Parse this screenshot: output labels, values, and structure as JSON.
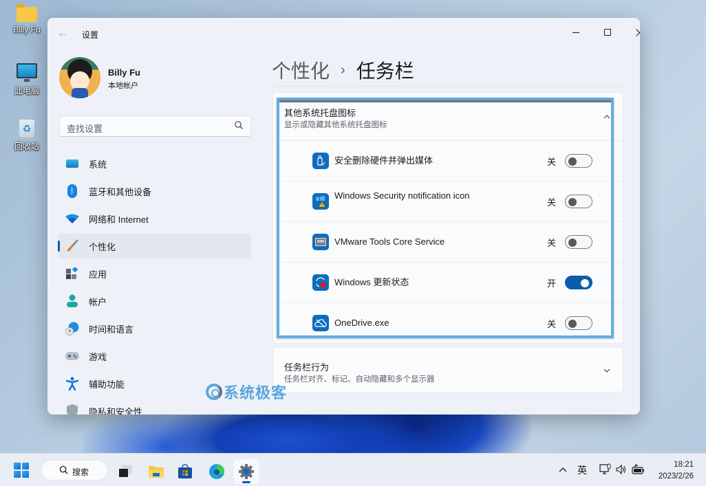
{
  "desktop": {
    "icons": [
      {
        "label": "Billy Fu",
        "icon": "folder-icon"
      },
      {
        "label": "此电脑",
        "icon": "computer-icon"
      },
      {
        "label": "回收站",
        "icon": "recycle-bin-icon"
      }
    ]
  },
  "window": {
    "title": "设置",
    "controls": {
      "minimize": "minimize",
      "maximize": "maximize",
      "close": "close"
    }
  },
  "user": {
    "name": "Billy Fu",
    "account_type": "本地帐户"
  },
  "search": {
    "placeholder": "查找设置"
  },
  "sidebar": {
    "items": [
      {
        "label": "系统",
        "icon": "system-icon",
        "active": false
      },
      {
        "label": "蓝牙和其他设备",
        "icon": "bluetooth-icon",
        "active": false
      },
      {
        "label": "网络和 Internet",
        "icon": "wifi-icon",
        "active": false
      },
      {
        "label": "个性化",
        "icon": "paintbrush-icon",
        "active": true
      },
      {
        "label": "应用",
        "icon": "apps-icon",
        "active": false
      },
      {
        "label": "帐户",
        "icon": "account-icon",
        "active": false
      },
      {
        "label": "时间和语言",
        "icon": "time-language-icon",
        "active": false
      },
      {
        "label": "游戏",
        "icon": "gamepad-icon",
        "active": false
      },
      {
        "label": "辅助功能",
        "icon": "accessibility-icon",
        "active": false
      },
      {
        "label": "隐私和安全性",
        "icon": "shield-icon",
        "active": false
      }
    ]
  },
  "breadcrumb": {
    "parent": "个性化",
    "separator": "›",
    "current": "任务栏"
  },
  "tray_section": {
    "title": "其他系统托盘图标",
    "subtitle": "显示或隐藏其他系统托盘图标",
    "expanded": true,
    "items": [
      {
        "label": "安全删除硬件并弹出媒体",
        "state_label": "关",
        "on": false,
        "icon": "usb-eject-icon"
      },
      {
        "label": "Windows Security notification icon",
        "state_label": "关",
        "on": false,
        "icon": "windows-security-icon"
      },
      {
        "label": "VMware Tools Core Service",
        "state_label": "关",
        "on": false,
        "icon": "vmware-icon"
      },
      {
        "label": "Windows 更新状态",
        "state_label": "开",
        "on": true,
        "icon": "windows-update-icon"
      },
      {
        "label": "OneDrive.exe",
        "state_label": "关",
        "on": false,
        "icon": "onedrive-icon"
      }
    ]
  },
  "behavior_section": {
    "title": "任务栏行为",
    "subtitle": "任务栏对齐、标记、自动隐藏和多个显示器",
    "expanded": false
  },
  "watermark": "系统极客",
  "taskbar": {
    "search_label": "搜索",
    "apps": [
      "task-view",
      "file-explorer",
      "microsoft-store",
      "edge",
      "settings"
    ],
    "tray": {
      "overflow": "^",
      "ime": "英"
    },
    "time": "18:21",
    "date": "2023/2/26"
  },
  "colors": {
    "accent": "#0b5cad",
    "highlight_border": "#62aee0"
  }
}
